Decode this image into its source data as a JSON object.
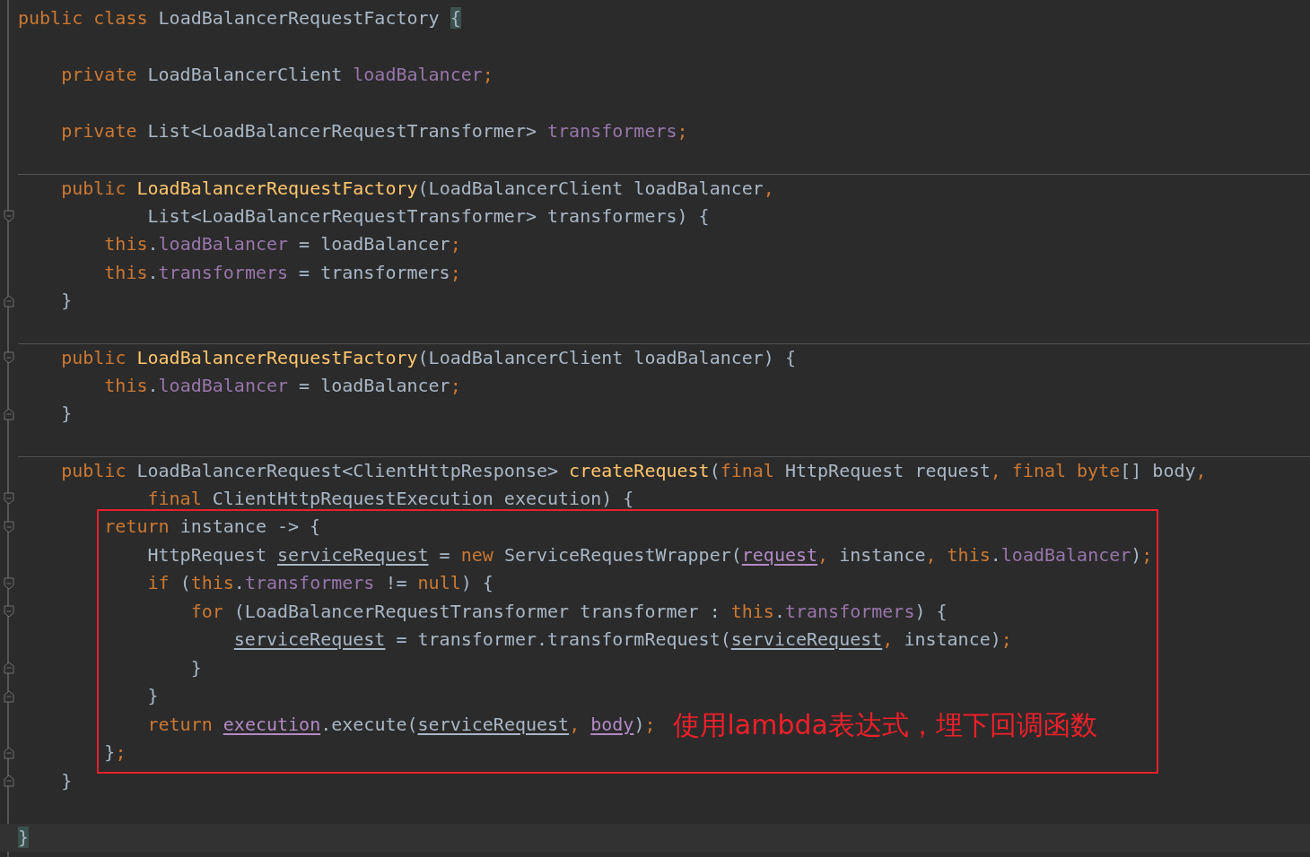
{
  "blocks": [
    {
      "kind": "plain",
      "lines": [
        {
          "kind": "plain",
          "separator": false,
          "current": false,
          "tokens": [
            {
              "kind": "keyword",
              "text": "public class "
            },
            {
              "kind": "text",
              "text": "LoadBalancerRequestFactory "
            },
            {
              "kind": "brace-match",
              "text": "{"
            }
          ]
        },
        {
          "kind": "plain",
          "separator": false,
          "current": false
        },
        {
          "kind": "plain",
          "separator": false,
          "current": false,
          "tokens": [
            {
              "kind": "keyword",
              "text": "    private "
            },
            {
              "kind": "text",
              "text": "LoadBalancerClient "
            },
            {
              "kind": "field",
              "text": "loadBalancer"
            },
            {
              "kind": "keyword",
              "text": ";"
            }
          ]
        },
        {
          "kind": "plain",
          "separator": false,
          "current": false
        },
        {
          "kind": "plain",
          "separator": false,
          "current": false,
          "tokens": [
            {
              "kind": "keyword",
              "text": "    private "
            },
            {
              "kind": "text",
              "text": "List<LoadBalancerRequestTransformer> "
            },
            {
              "kind": "field",
              "text": "transformers"
            },
            {
              "kind": "keyword",
              "text": ";"
            }
          ]
        },
        {
          "kind": "plain",
          "separator": false,
          "current": false
        },
        {
          "kind": "plain",
          "separator": true,
          "current": false,
          "tokens": [
            {
              "kind": "keyword",
              "text": "    public "
            },
            {
              "kind": "method",
              "text": "LoadBalancerRequestFactory"
            },
            {
              "kind": "text",
              "text": "(LoadBalancerClient loadBalancer"
            },
            {
              "kind": "keyword",
              "text": ","
            }
          ]
        },
        {
          "kind": "fold-start",
          "separator": false,
          "current": false,
          "tokens": [
            {
              "kind": "text",
              "text": "            List<LoadBalancerRequestTransformer> transformers) {"
            }
          ]
        },
        {
          "kind": "plain",
          "separator": false,
          "current": false,
          "tokens": [
            {
              "kind": "keyword",
              "text": "        this"
            },
            {
              "kind": "text",
              "text": "."
            },
            {
              "kind": "field",
              "text": "loadBalancer"
            },
            {
              "kind": "text",
              "text": " = loadBalancer"
            },
            {
              "kind": "keyword",
              "text": ";"
            }
          ]
        },
        {
          "kind": "plain",
          "separator": false,
          "current": false,
          "tokens": [
            {
              "kind": "keyword",
              "text": "        this"
            },
            {
              "kind": "text",
              "text": "."
            },
            {
              "kind": "field",
              "text": "transformers"
            },
            {
              "kind": "text",
              "text": " = transformers"
            },
            {
              "kind": "keyword",
              "text": ";"
            }
          ]
        },
        {
          "kind": "fold-end",
          "separator": false,
          "current": false,
          "tokens": [
            {
              "kind": "text",
              "text": "    }"
            }
          ]
        },
        {
          "kind": "plain",
          "separator": false,
          "current": false
        },
        {
          "kind": "fold-start",
          "separator": true,
          "current": false,
          "tokens": [
            {
              "kind": "keyword",
              "text": "    public "
            },
            {
              "kind": "method",
              "text": "LoadBalancerRequestFactory"
            },
            {
              "kind": "text",
              "text": "(LoadBalancerClient loadBalancer) {"
            }
          ]
        },
        {
          "kind": "plain",
          "separator": false,
          "current": false,
          "tokens": [
            {
              "kind": "keyword",
              "text": "        this"
            },
            {
              "kind": "text",
              "text": "."
            },
            {
              "kind": "field",
              "text": "loadBalancer"
            },
            {
              "kind": "text",
              "text": " = loadBalancer"
            },
            {
              "kind": "keyword",
              "text": ";"
            }
          ]
        },
        {
          "kind": "fold-end",
          "separator": false,
          "current": false,
          "tokens": [
            {
              "kind": "text",
              "text": "    }"
            }
          ]
        },
        {
          "kind": "plain",
          "separator": false,
          "current": false
        },
        {
          "kind": "plain",
          "separator": true,
          "current": false,
          "tokens": [
            {
              "kind": "keyword",
              "text": "    public "
            },
            {
              "kind": "text",
              "text": "LoadBalancerRequest<ClientHttpResponse> "
            },
            {
              "kind": "method",
              "text": "createRequest"
            },
            {
              "kind": "text",
              "text": "("
            },
            {
              "kind": "keyword",
              "text": "final "
            },
            {
              "kind": "text",
              "text": "HttpRequest request"
            },
            {
              "kind": "keyword",
              "text": ", final byte"
            },
            {
              "kind": "text",
              "text": "[] body"
            },
            {
              "kind": "keyword",
              "text": ","
            }
          ]
        },
        {
          "kind": "fold-start",
          "separator": false,
          "current": false,
          "tokens": [
            {
              "kind": "keyword",
              "text": "            final "
            },
            {
              "kind": "text",
              "text": "ClientHttpRequestExecution execution) {"
            }
          ]
        }
      ]
    },
    {
      "kind": "boxed",
      "lines": [
        {
          "kind": "fold-start",
          "separator": false,
          "current": false,
          "tokens": [
            {
              "kind": "keyword",
              "text": "        return "
            },
            {
              "kind": "text",
              "text": "instance -> {"
            }
          ]
        },
        {
          "kind": "plain",
          "separator": false,
          "current": false,
          "tokens": [
            {
              "kind": "text",
              "text": "            HttpRequest "
            },
            {
              "kind": "local-underlined",
              "text": "serviceRequest"
            },
            {
              "kind": "text",
              "text": " = "
            },
            {
              "kind": "keyword",
              "text": "new "
            },
            {
              "kind": "text",
              "text": "ServiceRequestWrapper("
            },
            {
              "kind": "param-underlined",
              "text": "request"
            },
            {
              "kind": "keyword",
              "text": ", "
            },
            {
              "kind": "text",
              "text": "instance"
            },
            {
              "kind": "keyword",
              "text": ", this"
            },
            {
              "kind": "text",
              "text": "."
            },
            {
              "kind": "field",
              "text": "loadBalancer"
            },
            {
              "kind": "text",
              "text": ")"
            },
            {
              "kind": "keyword",
              "text": ";"
            }
          ]
        },
        {
          "kind": "fold-start",
          "separator": false,
          "current": false,
          "tokens": [
            {
              "kind": "keyword",
              "text": "            if "
            },
            {
              "kind": "text",
              "text": "("
            },
            {
              "kind": "keyword",
              "text": "this"
            },
            {
              "kind": "text",
              "text": "."
            },
            {
              "kind": "field",
              "text": "transformers"
            },
            {
              "kind": "text",
              "text": " != "
            },
            {
              "kind": "keyword",
              "text": "null"
            },
            {
              "kind": "text",
              "text": ") {"
            }
          ]
        },
        {
          "kind": "fold-start",
          "separator": false,
          "current": false,
          "tokens": [
            {
              "kind": "keyword",
              "text": "                for "
            },
            {
              "kind": "text",
              "text": "(LoadBalancerRequestTransformer transformer : "
            },
            {
              "kind": "keyword",
              "text": "this"
            },
            {
              "kind": "text",
              "text": "."
            },
            {
              "kind": "field",
              "text": "transformers"
            },
            {
              "kind": "text",
              "text": ") {"
            }
          ]
        },
        {
          "kind": "plain",
          "separator": false,
          "current": false,
          "tokens": [
            {
              "kind": "local-underlined",
              "text": "                    serviceRequest"
            },
            {
              "kind": "text",
              "text": " = transformer.transformRequest("
            },
            {
              "kind": "local-underlined",
              "text": "serviceRequest"
            },
            {
              "kind": "keyword",
              "text": ", "
            },
            {
              "kind": "text",
              "text": "instance)"
            },
            {
              "kind": "keyword",
              "text": ";"
            }
          ]
        },
        {
          "kind": "fold-end",
          "separator": false,
          "current": false,
          "tokens": [
            {
              "kind": "text",
              "text": "                }"
            }
          ]
        },
        {
          "kind": "fold-end",
          "separator": false,
          "current": false,
          "tokens": [
            {
              "kind": "text",
              "text": "            }"
            }
          ]
        },
        {
          "kind": "plain",
          "separator": false,
          "current": false,
          "note": "使用lambda表达式，埋下回调函数",
          "tokens": [
            {
              "kind": "keyword",
              "text": "            return "
            },
            {
              "kind": "param-underlined",
              "text": "execution"
            },
            {
              "kind": "text",
              "text": ".execute("
            },
            {
              "kind": "local-underlined",
              "text": "serviceRequest"
            },
            {
              "kind": "keyword",
              "text": ", "
            },
            {
              "kind": "param-underlined",
              "text": "body"
            },
            {
              "kind": "text",
              "text": ")"
            },
            {
              "kind": "keyword",
              "text": ";"
            }
          ]
        },
        {
          "kind": "fold-end",
          "separator": false,
          "current": false,
          "tokens": [
            {
              "kind": "text",
              "text": "        }"
            },
            {
              "kind": "keyword",
              "text": ";"
            }
          ]
        }
      ]
    },
    {
      "kind": "plain",
      "lines": [
        {
          "kind": "fold-end",
          "separator": false,
          "current": false,
          "tokens": [
            {
              "kind": "text",
              "text": "    }"
            }
          ]
        },
        {
          "kind": "plain",
          "separator": false,
          "current": false
        },
        {
          "kind": "plain",
          "separator": false,
          "current": true,
          "tokens": [
            {
              "kind": "brace-match",
              "text": "}"
            }
          ]
        }
      ]
    }
  ]
}
